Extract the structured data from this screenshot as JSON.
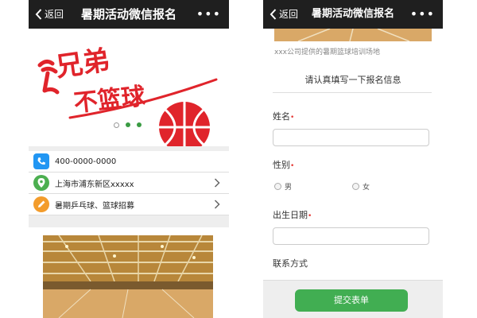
{
  "titlebar": {
    "back_label": "返回",
    "title": "暑期活动微信报名",
    "more_label": "•••"
  },
  "banner": {
    "line1": "兄弟",
    "line2": "不篮球",
    "slides": 3,
    "active_slide": 2
  },
  "info": {
    "phone": "400-0000-0000",
    "address": "上海市浦东新区xxxxx",
    "activities": "暑期乒乓球、篮球招募"
  },
  "venue": {
    "caption": "xxx公司提供的暑期篮球培训场地"
  },
  "form": {
    "heading": "请认真填写一下报名信息",
    "name_label": "姓名",
    "gender_label": "性别",
    "gender_options": [
      "男",
      "女"
    ],
    "birthdate_label": "出生日期",
    "contact_label": "联系方式",
    "required_mark": "•",
    "submit_label": "提交表单"
  },
  "colors": {
    "titlebar_bg": "#1f1f1f",
    "accent_green": "#41ae52",
    "banner_red": "#e0242b",
    "phone_icon": "#2196f3",
    "location_icon": "#4caf50",
    "edit_icon": "#f39c2b"
  }
}
